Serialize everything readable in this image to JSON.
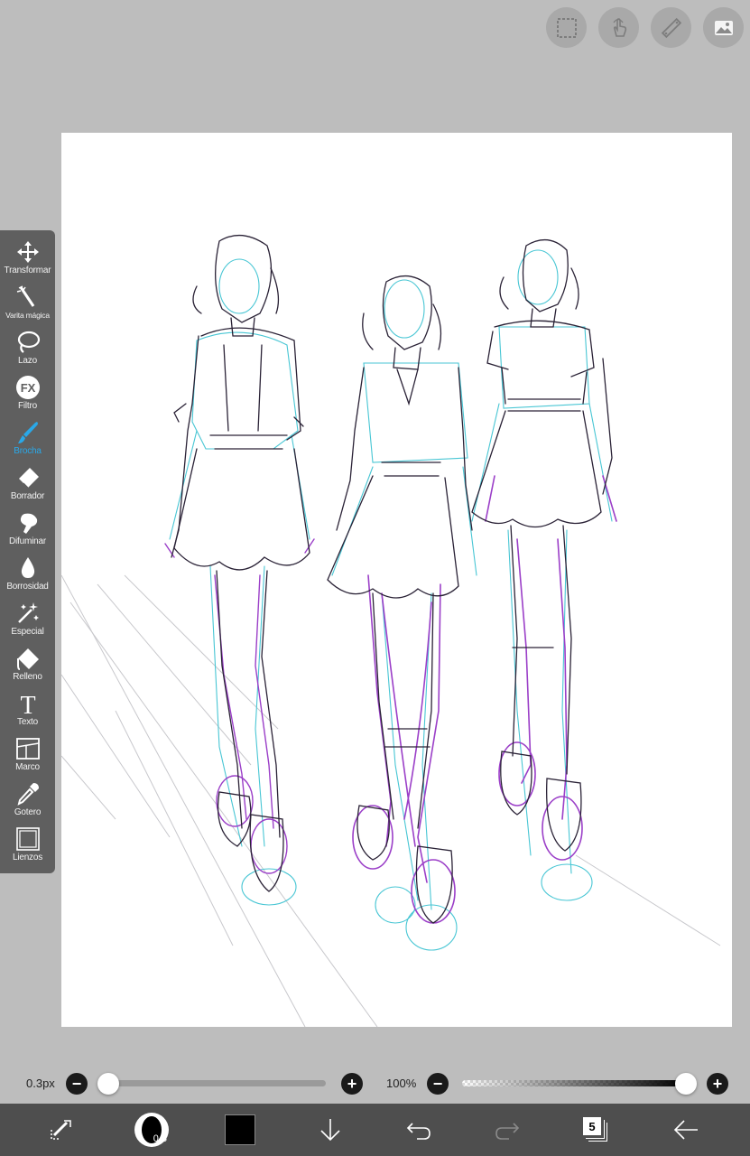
{
  "top_buttons": [
    {
      "name": "selection-icon"
    },
    {
      "name": "touch-hand-icon"
    },
    {
      "name": "ruler-icon"
    },
    {
      "name": "image-icon"
    }
  ],
  "tools": [
    {
      "name": "transform",
      "icon": "move-arrows-icon",
      "label": "Transformar"
    },
    {
      "name": "magic-wand",
      "icon": "magic-wand-icon",
      "label": "Varita mágica"
    },
    {
      "name": "lasso",
      "icon": "lasso-icon",
      "label": "Lazo"
    },
    {
      "name": "filter",
      "icon": "fx-icon",
      "label": "Filtro",
      "icon_text": "FX"
    },
    {
      "name": "brush",
      "icon": "brush-icon",
      "label": "Brocha",
      "active": true
    },
    {
      "name": "eraser",
      "icon": "eraser-icon",
      "label": "Borrador"
    },
    {
      "name": "smudge",
      "icon": "smudge-icon",
      "label": "Difuminar"
    },
    {
      "name": "blur",
      "icon": "drop-icon",
      "label": "Borrosidad"
    },
    {
      "name": "special",
      "icon": "sparkle-icon",
      "label": "Especial"
    },
    {
      "name": "fill",
      "icon": "fill-icon",
      "label": "Relleno"
    },
    {
      "name": "text",
      "icon": "text-icon",
      "label": "Texto",
      "icon_text": "T"
    },
    {
      "name": "frame",
      "icon": "frame-icon",
      "label": "Marco"
    },
    {
      "name": "eyedropper",
      "icon": "eyedropper-icon",
      "label": "Gotero"
    },
    {
      "name": "canvas",
      "icon": "canvas-icon",
      "label": "Lienzos"
    }
  ],
  "brush_size": {
    "value_text": "0.3px",
    "fraction": 0.0
  },
  "opacity": {
    "value_text": "100%",
    "fraction": 1.0
  },
  "bottom_bar": {
    "brush_size_badge": "0.3",
    "layer_count": "5",
    "current_color": "#000000"
  },
  "colors": {
    "accent": "#2aa8e8",
    "toolbar_bg": "#5f5f5f",
    "bottom_bar_bg": "#4e4e4e",
    "workspace_bg": "#bdbdbd"
  }
}
